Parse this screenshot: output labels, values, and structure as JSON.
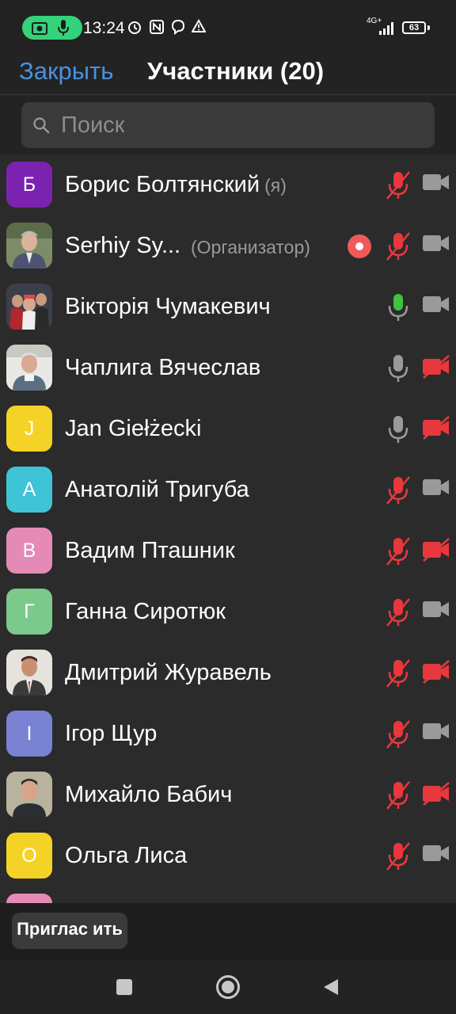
{
  "status_bar": {
    "time": "13:24",
    "network": "4G+",
    "battery": "63",
    "icons": [
      "camera-icon",
      "mic-icon",
      "alarm-icon",
      "nfc-icon",
      "viber-icon",
      "warning-icon",
      "signal-icon",
      "battery-icon"
    ]
  },
  "header": {
    "close_label": "Закрыть",
    "title": "Участники (20)"
  },
  "search": {
    "placeholder": "Поиск"
  },
  "participants": [
    {
      "initial": "Б",
      "name": "Борис Болтянский",
      "role": "(я)",
      "avatar_color": "#7b23b0",
      "mic": "muted",
      "video": "off"
    },
    {
      "initial": "",
      "name": "Serhiy Sy...",
      "role": "(Организатор)",
      "avatar_color": "#6f7d5f",
      "mic": "muted",
      "video": "off",
      "recording": true
    },
    {
      "initial": "",
      "name": "Вікторія Чумакевич",
      "role": "",
      "avatar_color": "#4a3f3a",
      "mic": "active",
      "video": "off"
    },
    {
      "initial": "",
      "name": "Чаплига Вячеслав",
      "role": "",
      "avatar_color": "#9aa3a9",
      "mic": "on",
      "video": "disabled"
    },
    {
      "initial": "J",
      "name": "Jan Giełżecki",
      "role": "",
      "avatar_color": "#f5d226",
      "mic": "on",
      "video": "disabled"
    },
    {
      "initial": "А",
      "name": "Анатолій Тригуба",
      "role": "",
      "avatar_color": "#3fc3d6",
      "mic": "muted",
      "video": "off"
    },
    {
      "initial": "В",
      "name": "Вадим Пташник",
      "role": "",
      "avatar_color": "#e58ab6",
      "mic": "muted",
      "video": "disabled"
    },
    {
      "initial": "Г",
      "name": "Ганна Сиротюк",
      "role": "",
      "avatar_color": "#7cc98c",
      "mic": "muted",
      "video": "off"
    },
    {
      "initial": "",
      "name": "Дмитрий Журавель",
      "role": "",
      "avatar_color": "#6b4a3c",
      "mic": "muted",
      "video": "disabled"
    },
    {
      "initial": "І",
      "name": "Ігор Щур",
      "role": "",
      "avatar_color": "#7a82d4",
      "mic": "muted",
      "video": "off"
    },
    {
      "initial": "",
      "name": "Михайло Бабич",
      "role": "",
      "avatar_color": "#4d5a4a",
      "mic": "muted",
      "video": "disabled"
    },
    {
      "initial": "О",
      "name": "Ольга Лиса",
      "role": "",
      "avatar_color": "#f5d226",
      "mic": "muted",
      "video": "off"
    },
    {
      "initial": "",
      "name": "",
      "role": "",
      "avatar_color": "#e58ab6",
      "mic": "muted",
      "video": "off"
    }
  ],
  "footer": {
    "invite_label": "Приглас ить"
  },
  "colors": {
    "accent": "#4a90e2",
    "muted_red": "#e8383d",
    "active_green": "#3ec43e"
  }
}
